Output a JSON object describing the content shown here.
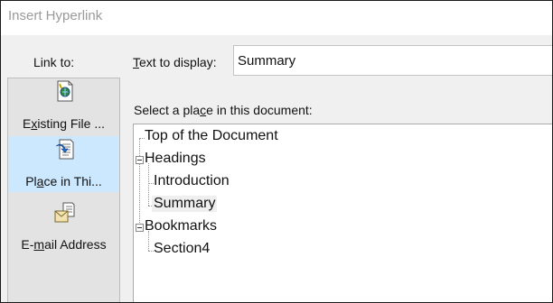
{
  "dialog": {
    "title": "Insert Hyperlink"
  },
  "sidebar": {
    "heading": "Link to:",
    "items": [
      {
        "label_pre": "E",
        "label_key": "x",
        "label_post": "isting File ...",
        "icon": "file-icon",
        "selected": false
      },
      {
        "label_pre": "Pl",
        "label_key": "a",
        "label_post": "ce in Thi...",
        "icon": "document-place-icon",
        "selected": true
      },
      {
        "label_pre": "E-",
        "label_key": "m",
        "label_post": "ail Address",
        "icon": "email-envelope-icon",
        "selected": false
      }
    ]
  },
  "text_to_display": {
    "label_key": "T",
    "label_rest": "ext to display:",
    "value": "Summary"
  },
  "place": {
    "label_pre": "Select a pla",
    "label_key": "c",
    "label_post": "e in this document:"
  },
  "tree": {
    "top": "Top of the Document",
    "headings": {
      "label": "Headings",
      "children": [
        "Introduction",
        "Summary"
      ]
    },
    "bookmarks": {
      "label": "Bookmarks",
      "children": [
        "Section4"
      ]
    },
    "selected": "Summary"
  }
}
